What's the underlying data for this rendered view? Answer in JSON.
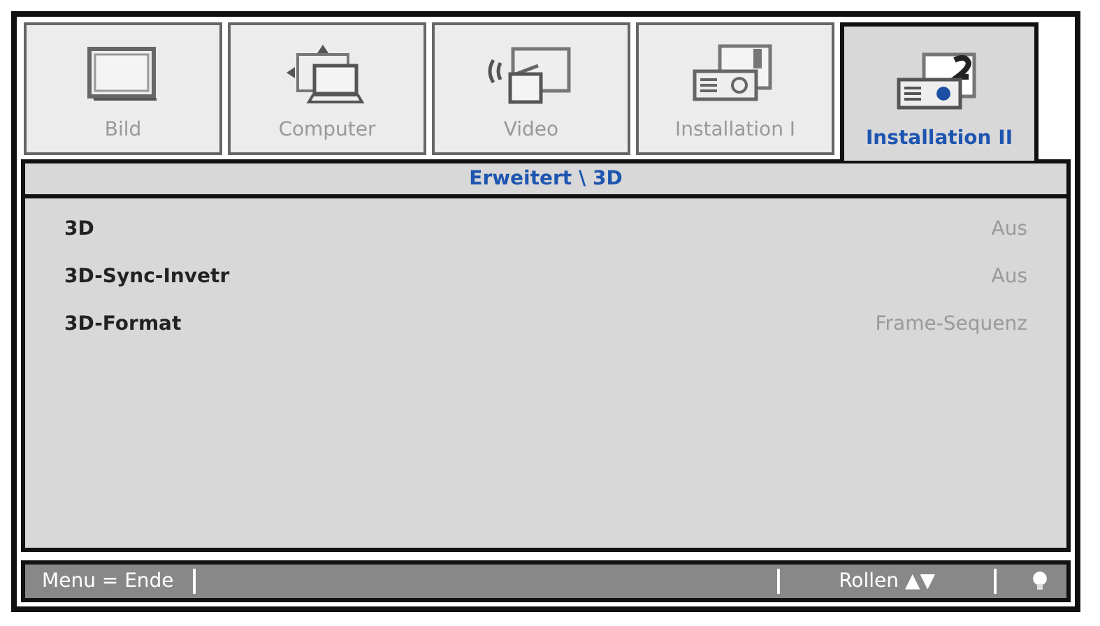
{
  "tabs": [
    {
      "label": "Bild",
      "selected": false
    },
    {
      "label": "Computer",
      "selected": false
    },
    {
      "label": "Video",
      "selected": false
    },
    {
      "label": "Installation I",
      "selected": false
    },
    {
      "label": "Installation II",
      "selected": true
    }
  ],
  "breadcrumb": "Erweitert \\ 3D",
  "settings": [
    {
      "label": "3D",
      "value": "Aus"
    },
    {
      "label": "3D-Sync-Invetr",
      "value": "Aus"
    },
    {
      "label": "3D-Format",
      "value": "Frame-Sequenz"
    }
  ],
  "status_bar": {
    "exit_hint": "Menu = Ende",
    "scroll_hint": "Rollen",
    "scroll_arrows": "▲▼"
  }
}
